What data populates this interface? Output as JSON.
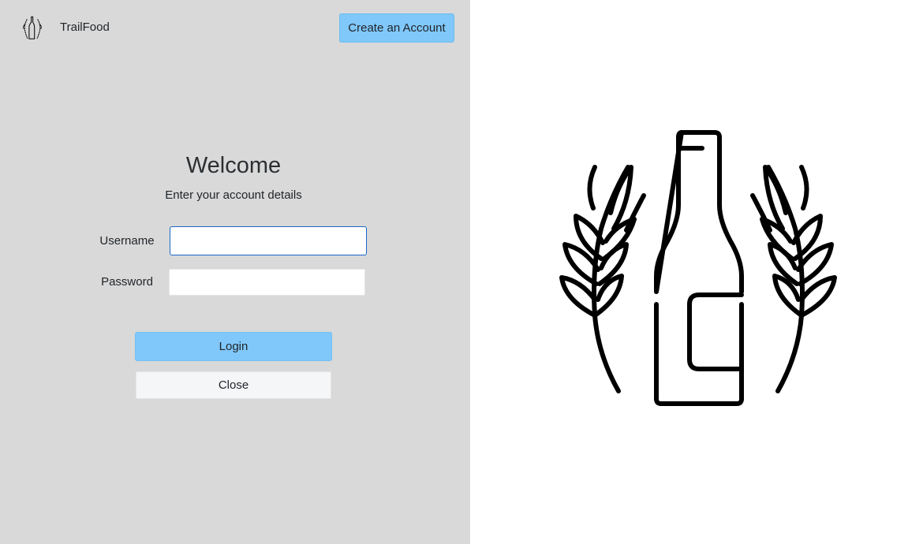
{
  "header": {
    "app_name": "TrailFood",
    "logo_icon": "bottle-wheat-icon",
    "create_account_label": "Create an Account"
  },
  "login": {
    "title": "Welcome",
    "subtitle": "Enter your account details",
    "username_label": "Username",
    "username_value": "",
    "password_label": "Password",
    "password_value": "",
    "login_label": "Login",
    "close_label": "Close"
  },
  "hero": {
    "icon": "bottle-wheat-icon"
  },
  "colors": {
    "left_panel_bg": "#d9d9d9",
    "accent_button": "#80c8fa",
    "focus_border": "#1a66c8",
    "close_button_bg": "#f5f6f8"
  }
}
